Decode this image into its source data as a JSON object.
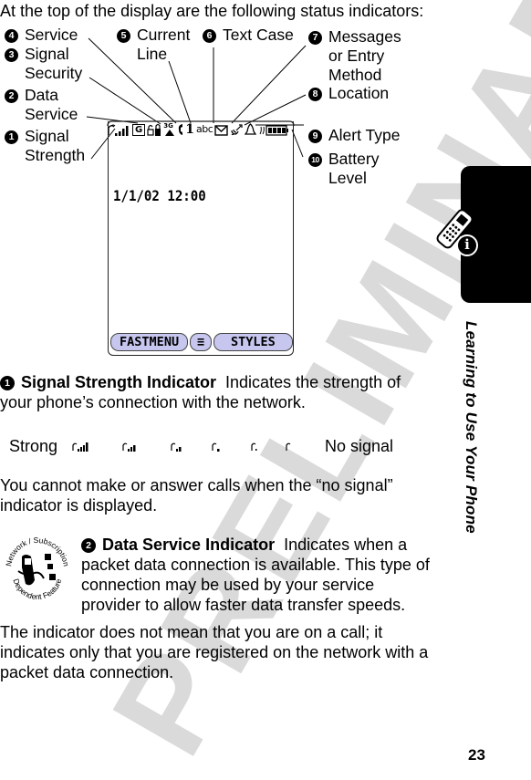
{
  "watermark": "PRELIMINARY",
  "intro": "At the top of the display are the following status indicators:",
  "callouts": [
    {
      "num": "1",
      "label_lines": [
        "Signal",
        "Strength"
      ]
    },
    {
      "num": "2",
      "label_lines": [
        "Data",
        "Service"
      ]
    },
    {
      "num": "3",
      "label_lines": [
        "Signal",
        "Security"
      ]
    },
    {
      "num": "4",
      "label_lines": [
        "Service"
      ]
    },
    {
      "num": "5",
      "label_lines": [
        "Current",
        "Line"
      ]
    },
    {
      "num": "6",
      "label_lines": [
        "Text Case"
      ]
    },
    {
      "num": "7",
      "label_lines": [
        "Messages",
        "or Entry",
        "Method"
      ]
    },
    {
      "num": "8",
      "label_lines": [
        "Location"
      ]
    },
    {
      "num": "9",
      "label_lines": [
        "Alert Type"
      ]
    },
    {
      "num": "10",
      "label_lines": [
        "Battery",
        "Level"
      ]
    }
  ],
  "phone_screen": {
    "status_icons": [
      "signal-strength-icon",
      "data-service-G-icon",
      "signal-security-lock-icon",
      "3G-service-icon",
      "current-line-1-icon",
      "text-case-abc-icon",
      "message-envelope-icon",
      "location-icon",
      "alert-bell-icon",
      "battery-icon"
    ],
    "data_service_glyph": "G",
    "service_glyph": "3G",
    "line_glyph": "1",
    "text_case_glyph": "abc",
    "datetime": "1/1/02 12:00",
    "softkey_left": "FASTMENU",
    "softkey_menu_glyph": "≡",
    "softkey_right": "STYLES",
    "softkey_color": "#c6c6ee"
  },
  "side_tab": {
    "title": "Learning to Use Your Phone",
    "icon": "phone-info-icon",
    "info_glyph": "i"
  },
  "section1": {
    "num": "1",
    "heading": "Signal Strength Indicator",
    "text_line1": "Indicates the strength of",
    "text_line2": "your phone’s connection with the network."
  },
  "signal_scale": {
    "left_label": "Strong",
    "right_label": "No signal",
    "levels": [
      5,
      4,
      3,
      2,
      1,
      0
    ]
  },
  "no_signal_note": {
    "line1": "You cannot make or answer calls when the “no signal”",
    "line2": "indicator is displayed."
  },
  "section2": {
    "num": "2",
    "heading": "Data Service Indicator",
    "lines": [
      "Indicates when a",
      "packet data connection is available. This type of",
      "connection may be used by your service",
      "provider to allow faster data transfer speeds.",
      "The indicator does not mean that you are on a call; it",
      "indicates only that you are registered on the network with a",
      "packet data connection."
    ],
    "feature_badge_top": "Network / Subscription",
    "feature_badge_bottom": "Dependent Feature"
  },
  "page_number": "23"
}
